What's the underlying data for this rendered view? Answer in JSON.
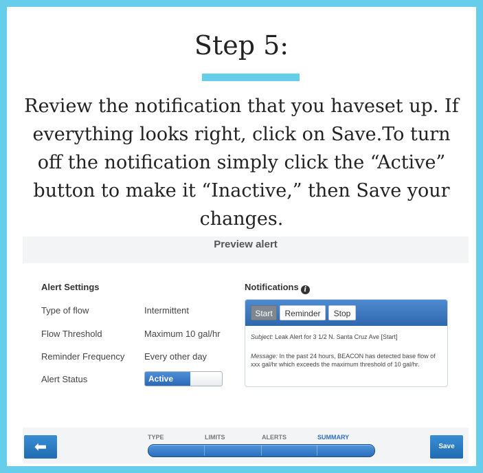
{
  "step_title": "Step 5:",
  "instructions": "Review the notification that you haveset up. If everything looks right, click on Save.To turn off the notification simply click the “Active” button to make it “Inactive,” then Save your changes.",
  "colors": {
    "frame": "#66cdeb",
    "accent_blue": "#2a68b7"
  },
  "app": {
    "header": "Preview alert",
    "alert_settings": {
      "title": "Alert Settings",
      "rows": [
        {
          "label": "Type of flow",
          "value": "Intermittent"
        },
        {
          "label": "Flow Threshold",
          "value": "Maximum 10 gal/hr"
        },
        {
          "label": "Reminder Frequency",
          "value": "Every other day"
        },
        {
          "label": "Alert Status"
        }
      ],
      "status_toggle": {
        "label": "Active",
        "state": "on"
      }
    },
    "notifications": {
      "title": "Notifications",
      "info_icon": "info-icon",
      "tabs": [
        {
          "label": "Start",
          "active": true
        },
        {
          "label": "Reminder",
          "active": false
        },
        {
          "label": "Stop",
          "active": false
        }
      ],
      "subject_label": "Subject:",
      "subject_text": " Leak Alert for 3 1/2 N. Santa Cruz Ave [Start]",
      "message_label": "Message:",
      "message_text": " In the past 24 hours, BEACON has detected base flow of xxx gal/hr which exceeds the maximum threshold of 10 gal/hr."
    },
    "footer": {
      "back_icon": "arrow-left-icon",
      "back_glyph": "⬅",
      "save_label": "Save",
      "steps": [
        "TYPE",
        "LIMITS",
        "ALERTS",
        "SUMMARY"
      ],
      "current_step": "SUMMARY",
      "progress": 1.0
    }
  }
}
